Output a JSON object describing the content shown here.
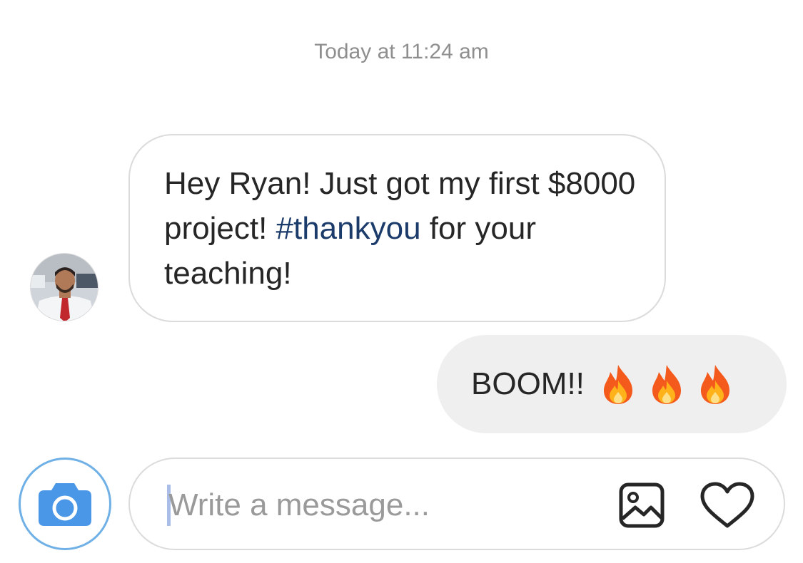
{
  "conversation": {
    "timestamp": "Today at 11:24 am",
    "messages": [
      {
        "direction": "incoming",
        "text_before": "Hey Ryan! Just got my first $8000 project! ",
        "hashtag": "#thankyou",
        "text_after": " for your teaching!"
      },
      {
        "direction": "outgoing",
        "text": "BOOM!!",
        "emoji": [
          "fire-emoji",
          "fire-emoji",
          "fire-emoji"
        ]
      }
    ]
  },
  "composer": {
    "placeholder": "Write a message...",
    "value": "",
    "icons": [
      "camera-icon",
      "image-icon",
      "heart-icon"
    ]
  },
  "colors": {
    "hashtag": "#1b3b6b",
    "outgoing_bubble": "#efefef",
    "camera_accent": "#4a97e8",
    "timestamp": "#8e8e8e"
  }
}
